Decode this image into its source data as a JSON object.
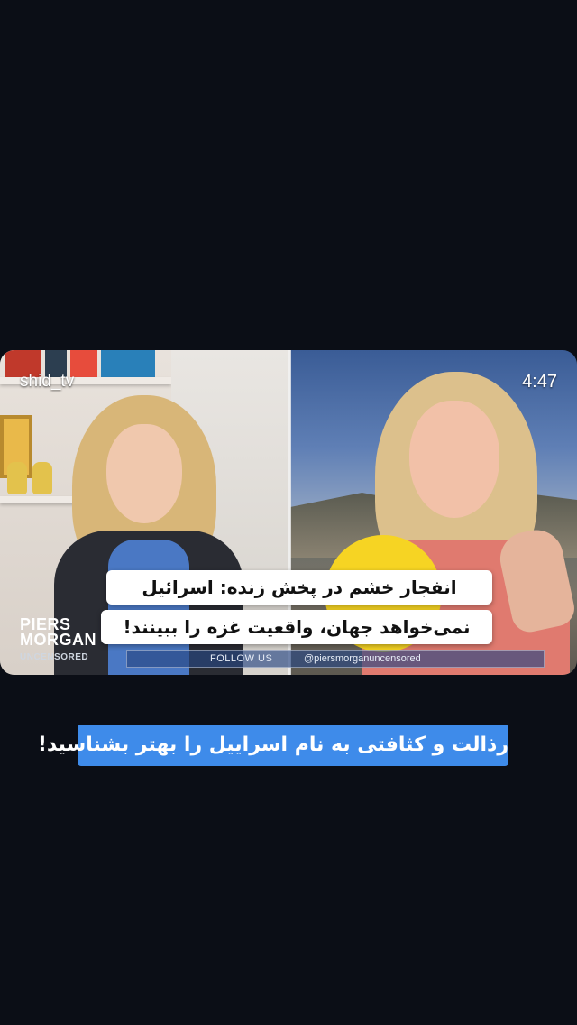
{
  "video": {
    "channel_label": "shid_tv",
    "duration": "4:47",
    "headline_line1": "انفجار خشم در پخش زنده: اسرائیل",
    "headline_line2": "نمی‌خواهد جهان، واقعیت غزه را ببینند!",
    "brand": {
      "line1": "PIERS",
      "line2": "MORGAN",
      "line3": "UNCENSORED"
    },
    "lower_bar": {
      "follow": "FOLLOW US",
      "handle": "@piersmorganuncensored"
    }
  },
  "subtitle": "رذالت و کثافتی به نام اسراییل را بهتر بشناسید!"
}
